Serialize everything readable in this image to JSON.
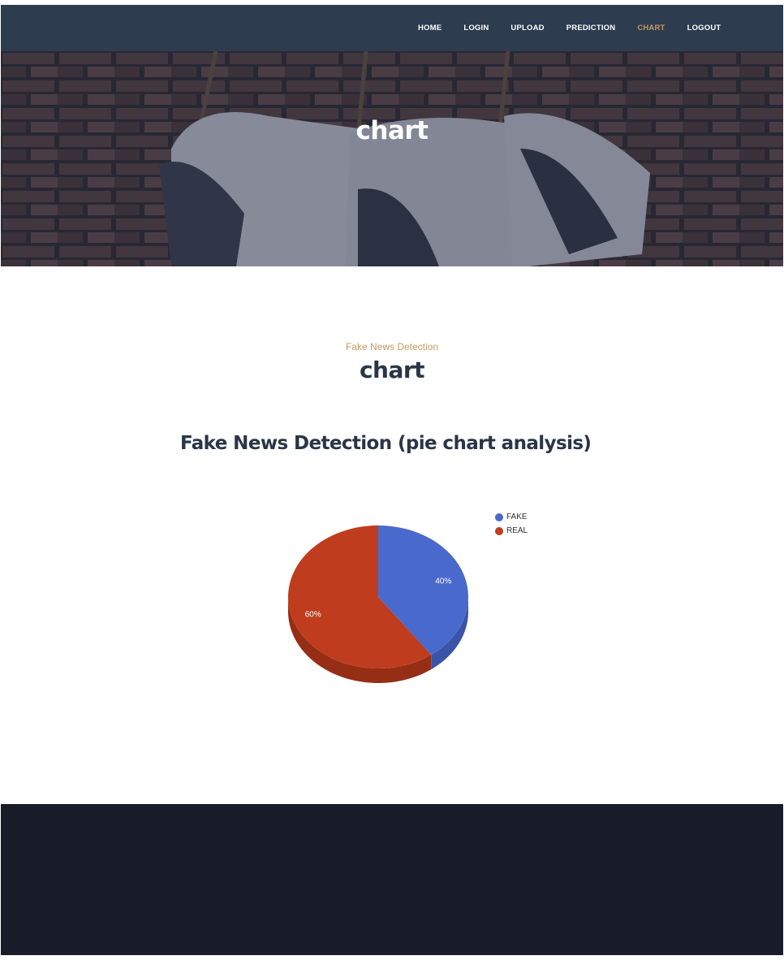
{
  "nav": {
    "items": [
      {
        "label": "HOME",
        "active": false
      },
      {
        "label": "LOGIN",
        "active": false
      },
      {
        "label": "UPLOAD",
        "active": false
      },
      {
        "label": "PREDICTION",
        "active": false
      },
      {
        "label": "CHART",
        "active": true
      },
      {
        "label": "LOGOUT",
        "active": false
      }
    ]
  },
  "hero": {
    "title": "chart"
  },
  "section": {
    "eyebrow": "Fake News Detection",
    "title": "chart"
  },
  "chart_heading": "Fake News Detection (pie chart analysis)",
  "colors": {
    "nav_bg": "#2e3c4f",
    "accent": "#c39a62",
    "heading": "#2a3547",
    "footer_bg": "#181c29",
    "fake": "#4a69cc",
    "real": "#bf3c1e"
  },
  "chart_data": {
    "type": "pie",
    "categories": [
      "FAKE",
      "REAL"
    ],
    "values": [
      40,
      60
    ],
    "data_labels": [
      "40%",
      "60%"
    ],
    "legend_position": "top-right",
    "three_d": true
  }
}
